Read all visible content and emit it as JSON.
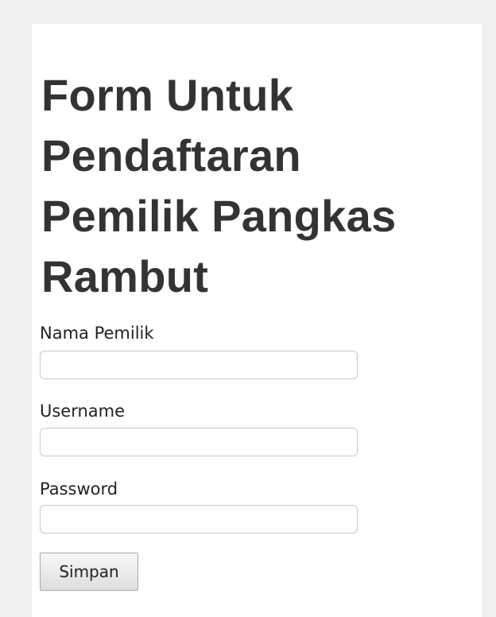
{
  "form": {
    "title": "Form Untuk Pendaftaran Pemilik Pangkas Rambut",
    "fields": [
      {
        "label": "Nama Pemilik",
        "value": "",
        "placeholder": ""
      },
      {
        "label": "Username",
        "value": "",
        "placeholder": ""
      },
      {
        "label": "Password",
        "value": "",
        "placeholder": ""
      }
    ],
    "submit_label": "Simpan"
  },
  "colors": {
    "page_background": "#f0f0f0",
    "card_background": "#ffffff",
    "title_text": "#333333",
    "field_border": "#c8c8c8"
  }
}
